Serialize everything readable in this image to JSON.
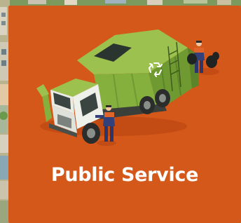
{
  "card": {
    "title": "Public Service",
    "background_color": "#d4581a",
    "title_color": "#ffffff",
    "illustration": "garbage-truck-with-workers",
    "icons": [
      "recycle-icon"
    ]
  }
}
